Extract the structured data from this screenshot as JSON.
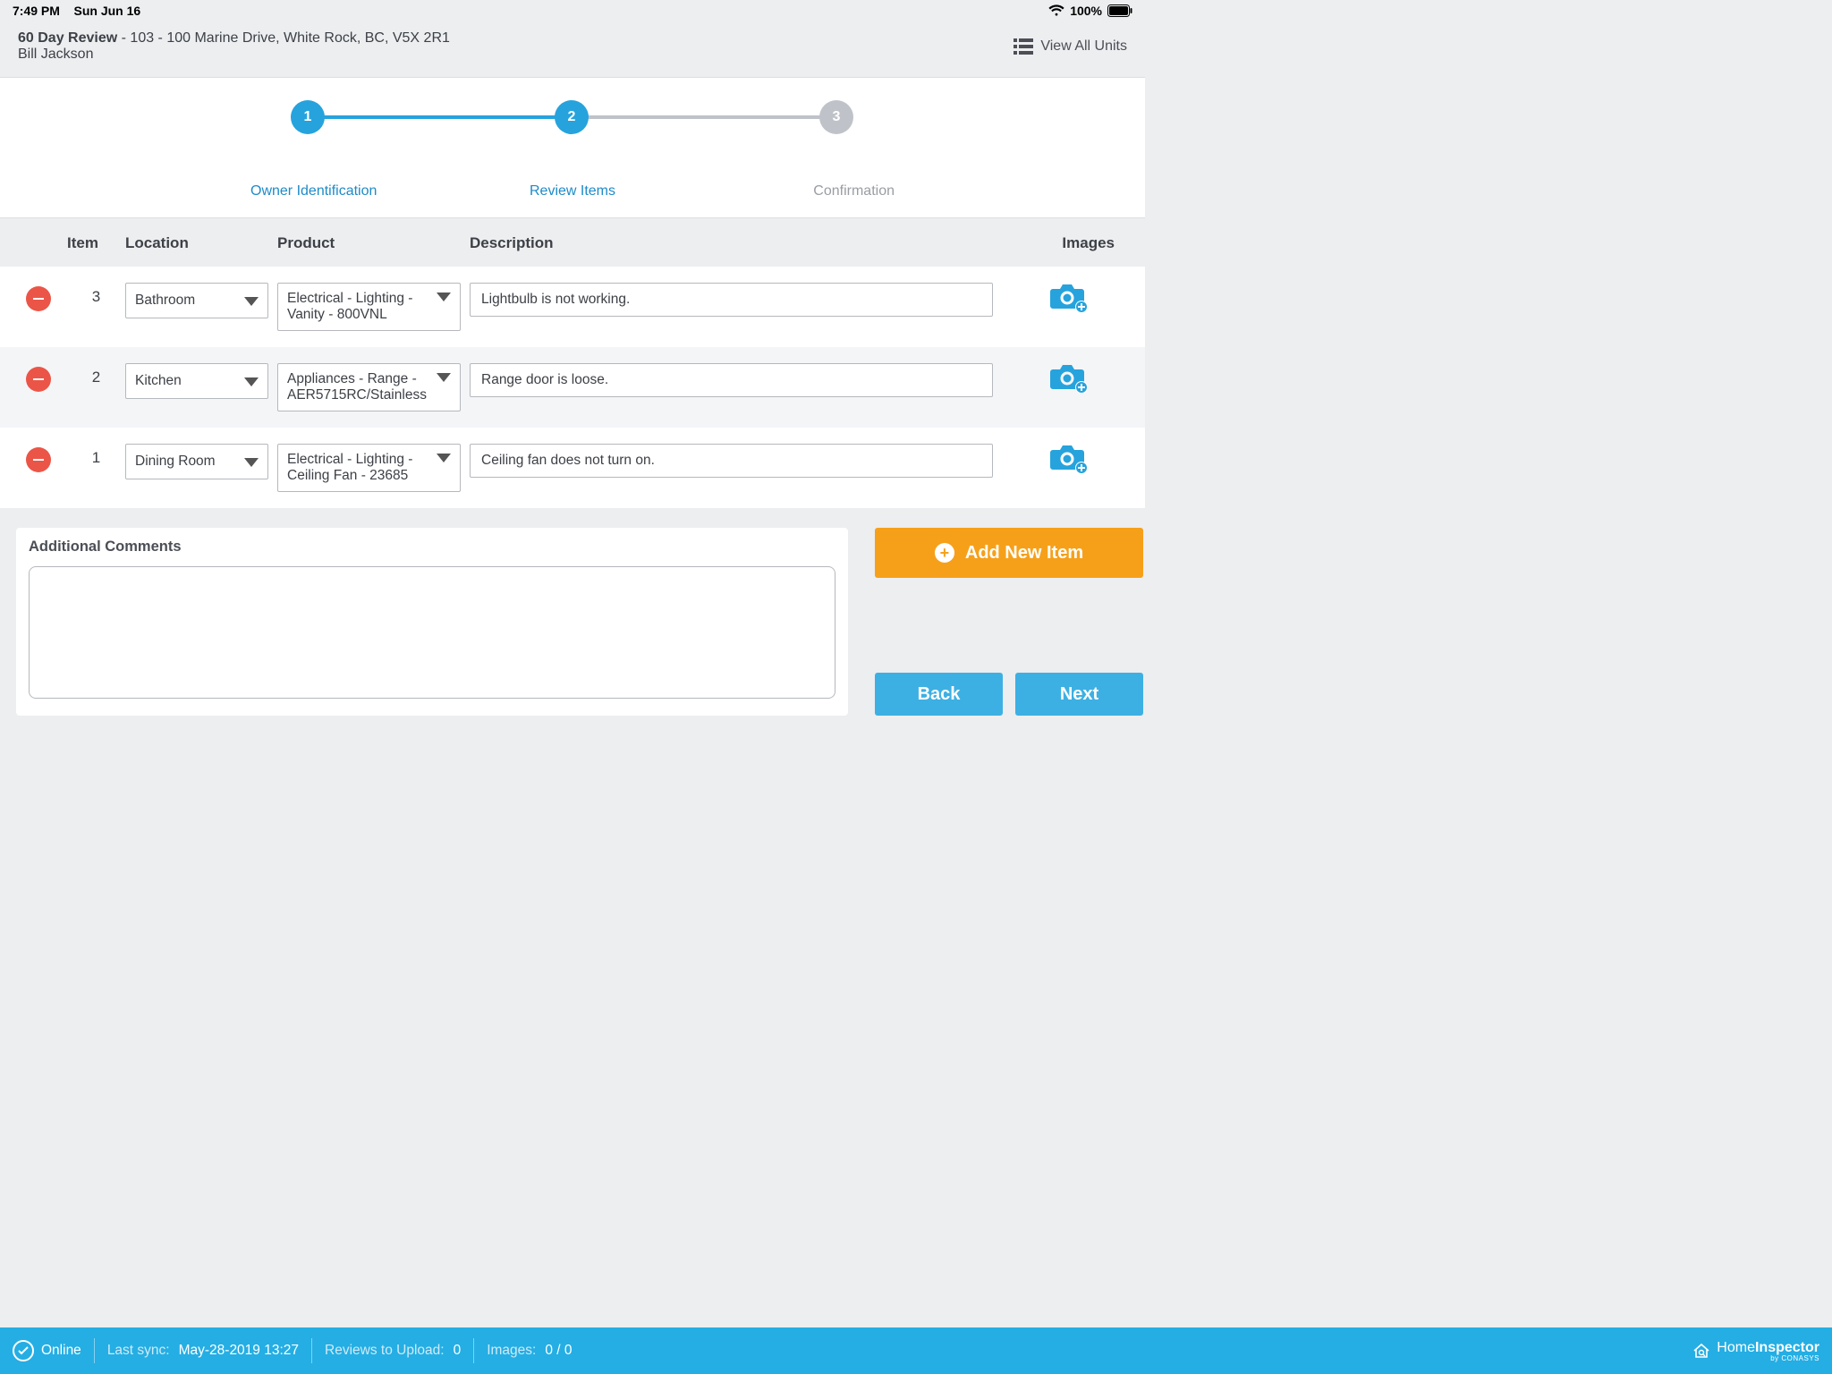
{
  "status": {
    "time": "7:49 PM",
    "date": "Sun Jun 16",
    "battery": "100%"
  },
  "header": {
    "review_title": "60 Day Review",
    "address": "- 103 - 100 Marine Drive, White Rock, BC, V5X 2R1",
    "person": "Bill Jackson",
    "view_all": "View All Units"
  },
  "stepper": {
    "step1": {
      "num": "1",
      "label": "Owner Identification"
    },
    "step2": {
      "num": "2",
      "label": "Review Items"
    },
    "step3": {
      "num": "3",
      "label": "Confirmation"
    }
  },
  "columns": {
    "item": "Item",
    "location": "Location",
    "product": "Product",
    "description": "Description",
    "images": "Images"
  },
  "rows": [
    {
      "num": "3",
      "location": "Bathroom",
      "product": "Electrical - Lighting - Vanity - 800VNL",
      "description": "Lightbulb is not working."
    },
    {
      "num": "2",
      "location": "Kitchen",
      "product": "Appliances - Range - AER5715RC/Stainless",
      "description": "Range door is loose."
    },
    {
      "num": "1",
      "location": "Dining Room",
      "product": "Electrical - Lighting - Ceiling Fan - 23685",
      "description": "Ceiling fan does not turn on."
    }
  ],
  "comments": {
    "label": "Additional Comments",
    "value": ""
  },
  "buttons": {
    "add": "Add New Item",
    "back": "Back",
    "next": "Next"
  },
  "footer": {
    "online": "Online",
    "sync_label": "Last sync:",
    "sync_value": "May-28-2019 13:27",
    "reviews_label": "Reviews to Upload:",
    "reviews_value": "0",
    "images_label": "Images:",
    "images_value": "0 / 0",
    "brand1": "Home",
    "brand2": "Inspector",
    "brand_by": "by CONASYS"
  }
}
